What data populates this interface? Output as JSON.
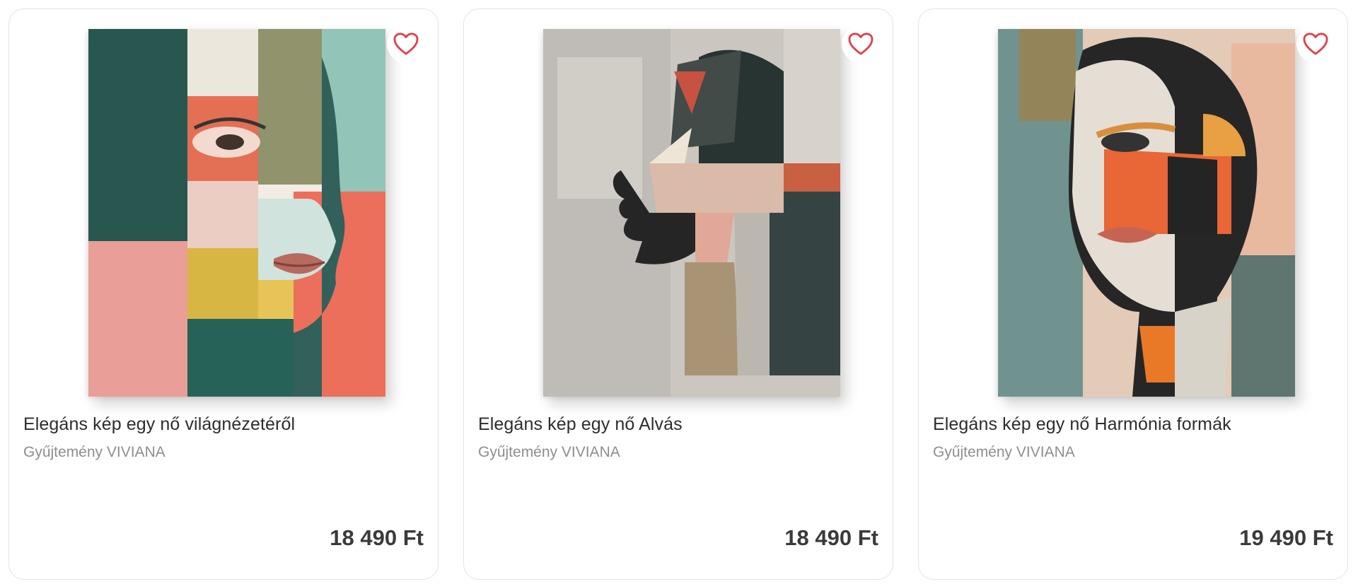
{
  "products": [
    {
      "title": "Elegáns kép egy nő világnézetéről",
      "collection": "Gyűjtemény VIVIANA",
      "price": "18 490 Ft",
      "favorite_icon": "heart-outline-icon"
    },
    {
      "title": "Elegáns kép egy nő Alvás",
      "collection": "Gyűjtemény VIVIANA",
      "price": "18 490 Ft",
      "favorite_icon": "heart-outline-icon"
    },
    {
      "title": "Elegáns kép egy nő Harmónia formák",
      "collection": "Gyűjtemény VIVIANA",
      "price": "19 490 Ft",
      "favorite_icon": "heart-outline-icon"
    }
  ],
  "colors": {
    "heart": "#e0404a",
    "card_border": "#e3e3e3",
    "price_text": "#3a3a3a",
    "collection_text": "#8e8e8e"
  }
}
